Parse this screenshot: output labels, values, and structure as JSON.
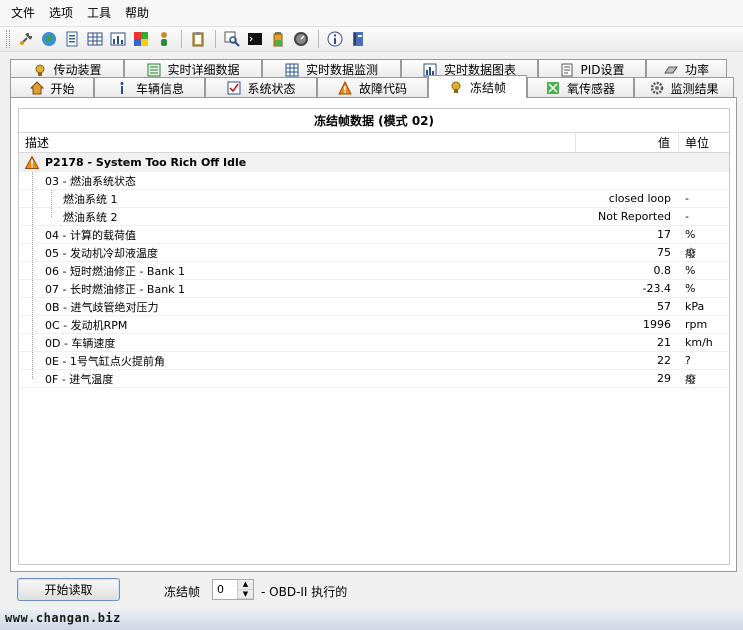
{
  "menu": [
    "文件",
    "选项",
    "工具",
    "帮助"
  ],
  "toolbar_icons": [
    "plug-icon",
    "globe-icon",
    "document-icon",
    "grid-icon",
    "chart-icon",
    "palette-icon",
    "person-icon",
    "clipboard-icon",
    "search-icon",
    "terminal-icon",
    "battery-icon",
    "gauge-icon",
    "info-icon",
    "book-icon"
  ],
  "tabs_row1": [
    {
      "label": "传动装置",
      "icon": "transmission-icon"
    },
    {
      "label": "实时详细数据",
      "icon": "list-icon"
    },
    {
      "label": "实时数据监测",
      "icon": "grid-icon"
    },
    {
      "label": "实时数据图表",
      "icon": "chart-icon"
    },
    {
      "label": "PID设置",
      "icon": "document-icon"
    },
    {
      "label": "功率",
      "icon": "dyno-icon"
    }
  ],
  "tabs_row2": [
    {
      "label": "开始",
      "icon": "home-icon"
    },
    {
      "label": "车辆信息",
      "icon": "info-icon"
    },
    {
      "label": "系统状态",
      "icon": "checkbox-icon"
    },
    {
      "label": "故障代码",
      "icon": "warning-icon"
    },
    {
      "label": "冻结帧",
      "icon": "freeze-icon",
      "active": true
    },
    {
      "label": "氧传感器",
      "icon": "sensor-icon"
    },
    {
      "label": "监测结果",
      "icon": "gear-icon"
    }
  ],
  "table": {
    "title": "冻结帧数据 (模式 02)",
    "headers": {
      "desc": "描述",
      "value": "值",
      "unit": "单位"
    },
    "group": "P2178 - System Too Rich Off Idle",
    "rows": [
      {
        "desc": "03 - 燃油系统状态",
        "value": "",
        "unit": "",
        "level": 1
      },
      {
        "desc": "燃油系统 1",
        "value": "closed loop",
        "unit": "-",
        "level": 2
      },
      {
        "desc": "燃油系统 2",
        "value": "Not Reported",
        "unit": "-",
        "level": 2
      },
      {
        "desc": "04 - 计算的载荷值",
        "value": "17",
        "unit": "%",
        "level": 1
      },
      {
        "desc": "05 - 发动机冷却液温度",
        "value": "75",
        "unit": "癈",
        "level": 1
      },
      {
        "desc": "06 - 短时燃油修正 - Bank 1",
        "value": "0.8",
        "unit": "%",
        "level": 1
      },
      {
        "desc": "07 - 长时燃油修正 - Bank 1",
        "value": "-23.4",
        "unit": "%",
        "level": 1
      },
      {
        "desc": "0B - 进气歧管绝对压力",
        "value": "57",
        "unit": "kPa",
        "level": 1
      },
      {
        "desc": "0C - 发动机RPM",
        "value": "1996",
        "unit": "rpm",
        "level": 1
      },
      {
        "desc": "0D - 车辆速度",
        "value": "21",
        "unit": "km/h",
        "level": 1
      },
      {
        "desc": "0E - 1号气缸点火提前角",
        "value": "22",
        "unit": "?",
        "level": 1
      },
      {
        "desc": "0F - 进气温度",
        "value": "29",
        "unit": "癈",
        "level": 1
      }
    ]
  },
  "controls": {
    "read_button": "开始读取",
    "freeze_frame_label": "冻结帧",
    "freeze_frame_value": "0",
    "obd_label": "- OBD-II 执行的"
  },
  "watermark": "www.changan.biz"
}
